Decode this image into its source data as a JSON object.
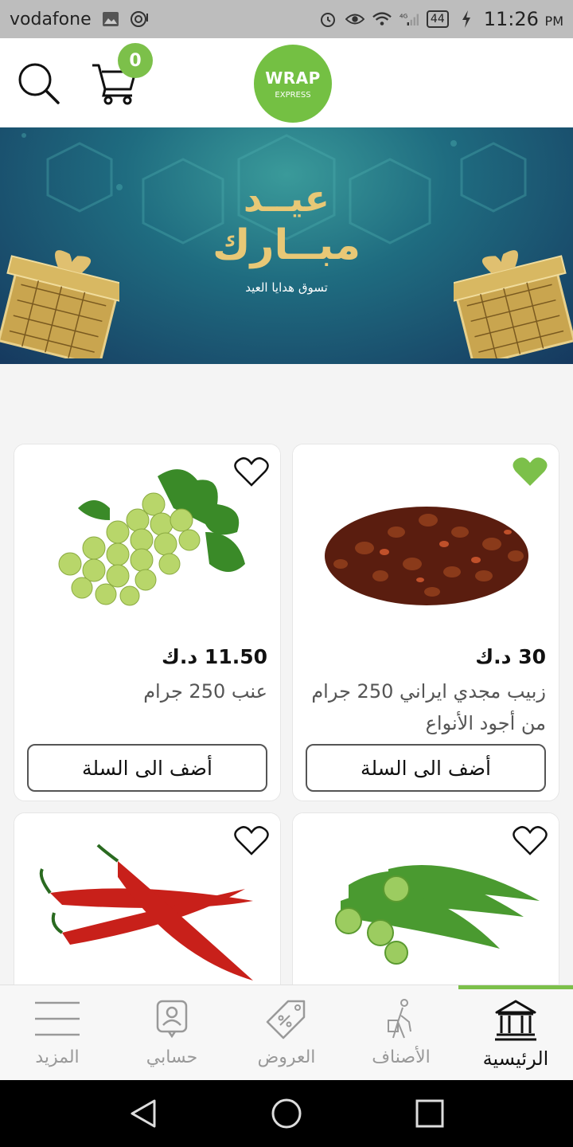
{
  "status_bar": {
    "carrier": "vodafone",
    "network": "4G",
    "battery": "44",
    "time": "11:26",
    "ampm": "PM"
  },
  "header": {
    "cart_count": "0",
    "logo_main": "WRAP",
    "logo_sub": "EXPRESS",
    "brand_color": "#74c043"
  },
  "banner": {
    "title_line1": "عيــد",
    "title_line2": "مبــارك",
    "subtitle": "تسوق هدايا العيد"
  },
  "products": [
    {
      "price": "30 د.ك",
      "name": "زبيب مجدي ايراني 250 جرام من أجود الأنواع",
      "favorite": true,
      "image": "raisins",
      "button": "أضف الى السلة"
    },
    {
      "price": "11.50 د.ك",
      "name": "عنب 250 جرام",
      "favorite": false,
      "image": "grapes",
      "button": "أضف الى السلة"
    },
    {
      "price": "",
      "name": "",
      "favorite": false,
      "image": "okra",
      "button": ""
    },
    {
      "price": "",
      "name": "",
      "favorite": false,
      "image": "chili-peppers",
      "button": ""
    }
  ],
  "bottom_nav": {
    "items": [
      {
        "label": "الرئيسية",
        "icon": "home-building-icon",
        "active": true
      },
      {
        "label": "الأصناف",
        "icon": "categories-icon",
        "active": false
      },
      {
        "label": "العروض",
        "icon": "offers-tag-icon",
        "active": false
      },
      {
        "label": "حسابي",
        "icon": "account-icon",
        "active": false
      },
      {
        "label": "المزيد",
        "icon": "menu-icon",
        "active": false
      }
    ],
    "accent_color": "#7cc04a"
  }
}
